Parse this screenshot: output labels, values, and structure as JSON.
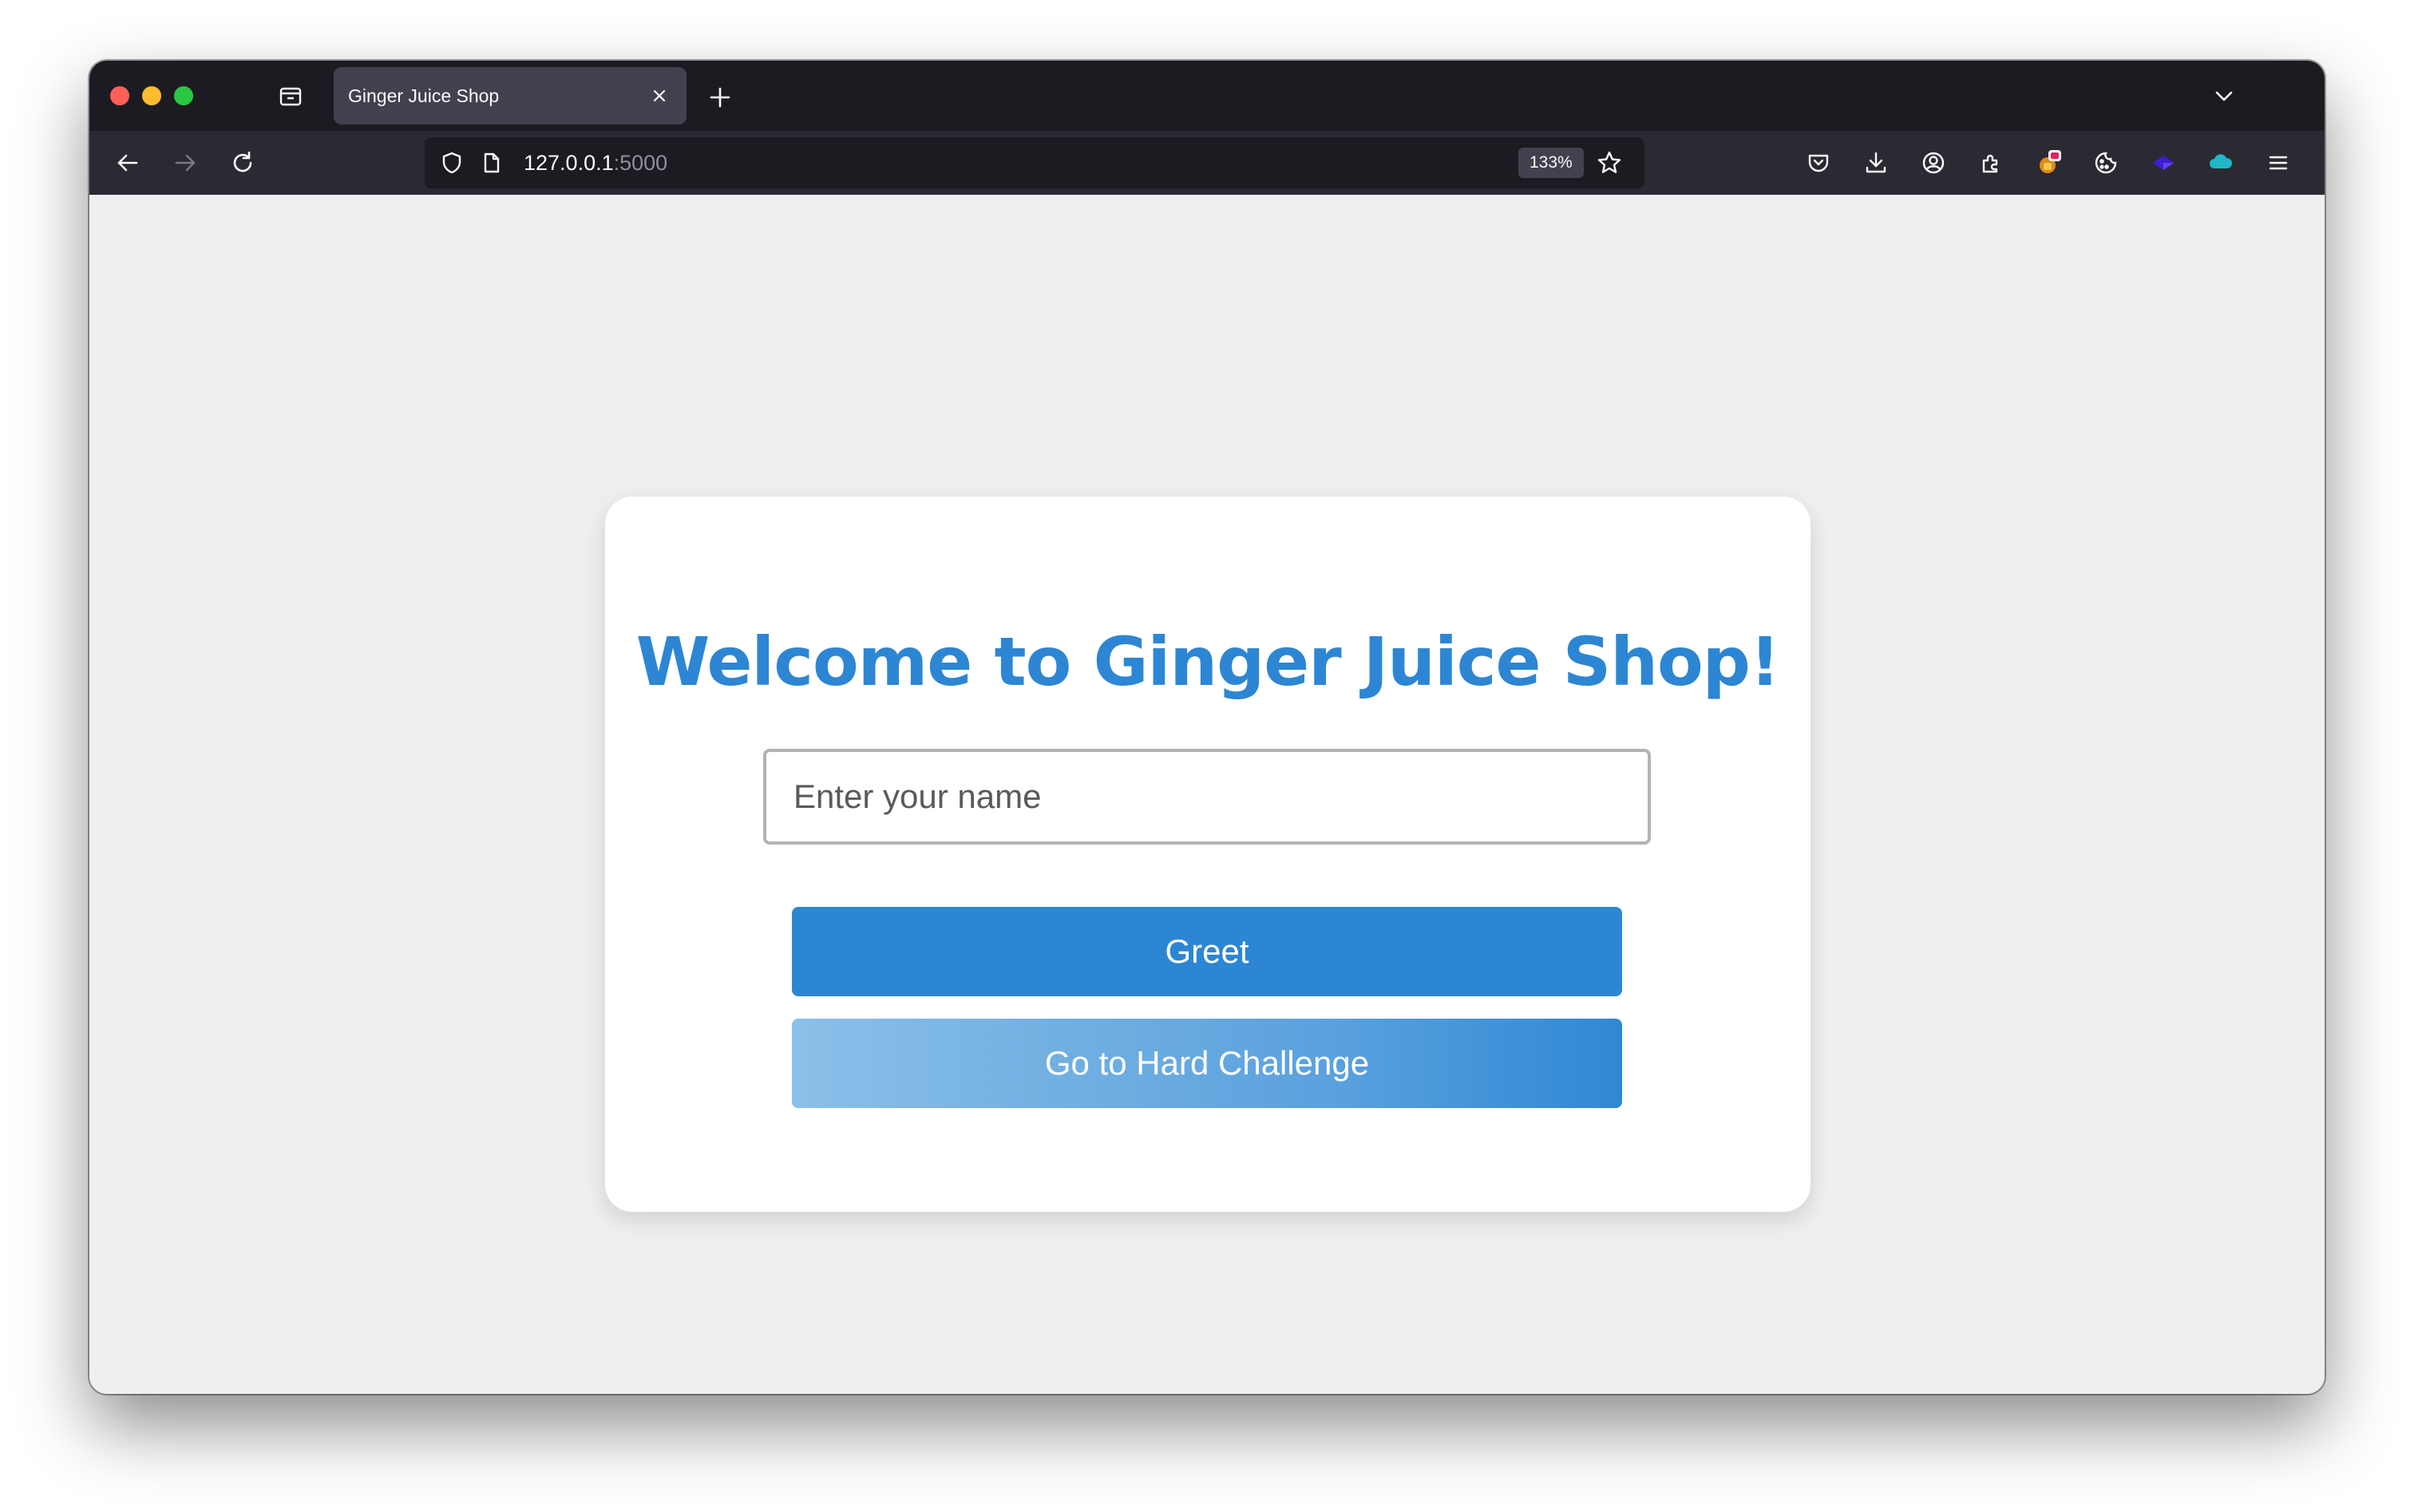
{
  "browser": {
    "tab": {
      "title": "Ginger Juice Shop"
    },
    "address_bar": {
      "host": "127.0.0.1",
      "port": ":5000",
      "zoom": "133%"
    },
    "icons": {
      "back": "arrow-left-icon",
      "forward": "arrow-right-icon",
      "reload": "reload-icon",
      "shield": "shield-icon",
      "page": "page-icon",
      "bookmark": "star-icon",
      "pocket": "pocket-icon",
      "downloads": "download-icon",
      "account": "account-icon",
      "extensions": "puzzle-icon",
      "menu": "hamburger-menu-icon"
    }
  },
  "page": {
    "heading": "Welcome to Ginger Juice Shop!",
    "name_input": {
      "placeholder": "Enter your name",
      "value": ""
    },
    "greet_button": "Greet",
    "hard_challenge_button": "Go to Hard Challenge",
    "colors": {
      "accent": "#2d86d3",
      "background": "#efefef",
      "card": "#ffffff"
    }
  }
}
